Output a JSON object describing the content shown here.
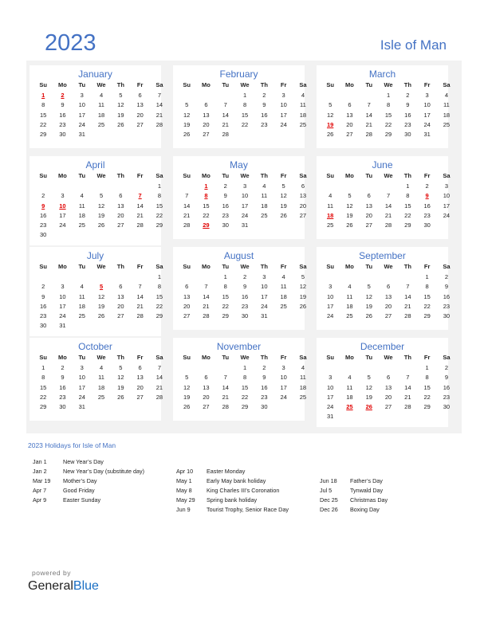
{
  "header": {
    "year": "2023",
    "country": "Isle of Man"
  },
  "weekdays": [
    "Su",
    "Mo",
    "Tu",
    "We",
    "Th",
    "Fr",
    "Sa"
  ],
  "colors": {
    "accent": "#4472c4",
    "holiday": "#e00000",
    "panel": "#f2f2f2"
  },
  "months": [
    {
      "name": "January",
      "start": 0,
      "days": 31,
      "holidays": [
        1,
        2
      ]
    },
    {
      "name": "February",
      "start": 3,
      "days": 28,
      "holidays": []
    },
    {
      "name": "March",
      "start": 3,
      "days": 31,
      "holidays": [
        19
      ]
    },
    {
      "name": "April",
      "start": 6,
      "days": 30,
      "holidays": [
        7,
        9,
        10
      ]
    },
    {
      "name": "May",
      "start": 1,
      "days": 31,
      "holidays": [
        1,
        8,
        29
      ]
    },
    {
      "name": "June",
      "start": 4,
      "days": 30,
      "holidays": [
        9,
        18
      ]
    },
    {
      "name": "July",
      "start": 6,
      "days": 31,
      "holidays": [
        5
      ]
    },
    {
      "name": "August",
      "start": 2,
      "days": 31,
      "holidays": []
    },
    {
      "name": "September",
      "start": 5,
      "days": 30,
      "holidays": []
    },
    {
      "name": "October",
      "start": 0,
      "days": 31,
      "holidays": []
    },
    {
      "name": "November",
      "start": 3,
      "days": 30,
      "holidays": []
    },
    {
      "name": "December",
      "start": 5,
      "days": 31,
      "holidays": [
        25,
        26
      ]
    }
  ],
  "holidays_title": "2023 Holidays for Isle of Man",
  "holiday_columns": [
    [
      {
        "date": "Jan 1",
        "name": "New Year’s Day"
      },
      {
        "date": "Jan 2",
        "name": "New Year’s Day (substitute day)"
      },
      {
        "date": "Mar 19",
        "name": "Mother’s Day"
      },
      {
        "date": "Apr 7",
        "name": "Good Friday"
      },
      {
        "date": "Apr 9",
        "name": "Easter Sunday"
      }
    ],
    [
      {
        "date": "Apr 10",
        "name": "Easter Monday"
      },
      {
        "date": "May 1",
        "name": "Early May bank holiday"
      },
      {
        "date": "May 8",
        "name": "King Charles III’s Coronation"
      },
      {
        "date": "May 29",
        "name": "Spring bank holiday"
      },
      {
        "date": "Jun 9",
        "name": "Tourist Trophy, Senior Race Day"
      }
    ],
    [
      {
        "date": "Jun 18",
        "name": "Father’s Day"
      },
      {
        "date": "Jul 5",
        "name": "Tynwald Day"
      },
      {
        "date": "Dec 25",
        "name": "Christmas Day"
      },
      {
        "date": "Dec 26",
        "name": "Boxing Day"
      }
    ]
  ],
  "footer": {
    "powered_by": "powered by",
    "brand_part1": "General",
    "brand_part2": "Blue"
  }
}
